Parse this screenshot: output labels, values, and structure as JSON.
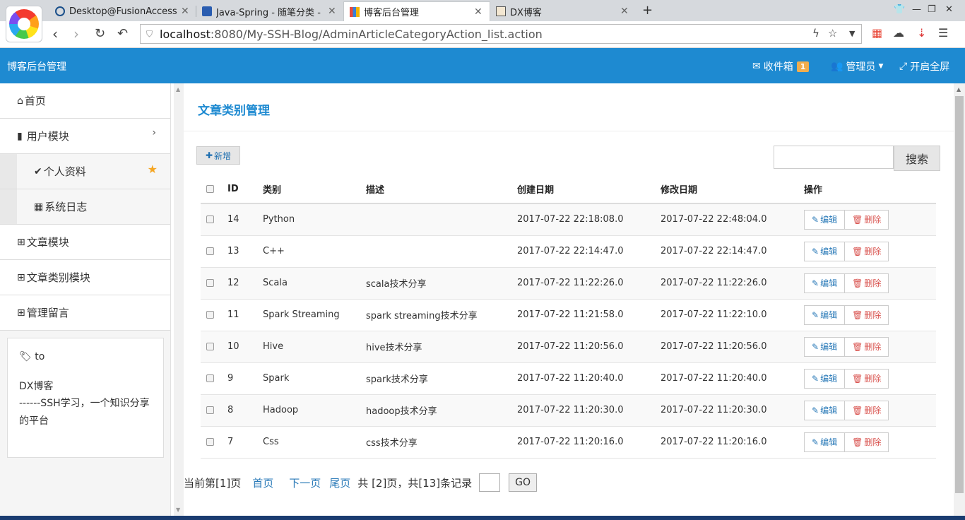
{
  "browser": {
    "tabs": [
      {
        "title": "Desktop@FusionAccess",
        "active": false
      },
      {
        "title": "Java-Spring - 随笔分类 - c",
        "active": false
      },
      {
        "title": "博客后台管理",
        "active": true
      },
      {
        "title": "DX博客",
        "active": false
      }
    ],
    "new_tab": "+",
    "url_host": "localhost",
    "url_path": ":8080/My-SSH-Blog/AdminArticleCategoryAction_list.action"
  },
  "header": {
    "brand": "博客后台管理",
    "inbox_label": "收件箱",
    "inbox_count": "1",
    "admin_label": "管理员",
    "fullscreen_label": "开启全屏"
  },
  "sidebar": {
    "items": [
      {
        "label": "首页",
        "icon": "home-icon"
      },
      {
        "label": "用户模块",
        "icon": "file-icon"
      },
      {
        "label": "个人资料",
        "icon": "check-icon"
      },
      {
        "label": "系统日志",
        "icon": "calendar-icon"
      },
      {
        "label": "文章模块",
        "icon": "table-icon"
      },
      {
        "label": "文章类别模块",
        "icon": "table-icon"
      },
      {
        "label": "管理留言",
        "icon": "table-icon"
      }
    ],
    "card": {
      "tag": "to",
      "name": "DX博客",
      "desc": "------SSH学习，一个知识分享的平台"
    }
  },
  "main": {
    "title": "文章类别管理",
    "add_label": "新增",
    "search_label": "搜索",
    "columns": [
      "ID",
      "类别",
      "描述",
      "创建日期",
      "修改日期",
      "操作"
    ],
    "edit_label": "编辑",
    "delete_label": "删除",
    "rows": [
      {
        "id": "14",
        "name": "Python",
        "desc": "",
        "created": "2017-07-22 22:18:08.0",
        "modified": "2017-07-22 22:48:04.0"
      },
      {
        "id": "13",
        "name": "C++",
        "desc": "",
        "created": "2017-07-22 22:14:47.0",
        "modified": "2017-07-22 22:14:47.0"
      },
      {
        "id": "12",
        "name": "Scala",
        "desc": "scala技术分享",
        "created": "2017-07-22 11:22:26.0",
        "modified": "2017-07-22 11:22:26.0"
      },
      {
        "id": "11",
        "name": "Spark Streaming",
        "desc": "spark streaming技术分享",
        "created": "2017-07-22 11:21:58.0",
        "modified": "2017-07-22 11:22:10.0"
      },
      {
        "id": "10",
        "name": "Hive",
        "desc": "hive技术分享",
        "created": "2017-07-22 11:20:56.0",
        "modified": "2017-07-22 11:20:56.0"
      },
      {
        "id": "9",
        "name": "Spark",
        "desc": "spark技术分享",
        "created": "2017-07-22 11:20:40.0",
        "modified": "2017-07-22 11:20:40.0"
      },
      {
        "id": "8",
        "name": "Hadoop",
        "desc": "hadoop技术分享",
        "created": "2017-07-22 11:20:30.0",
        "modified": "2017-07-22 11:20:30.0"
      },
      {
        "id": "7",
        "name": "Css",
        "desc": "css技术分享",
        "created": "2017-07-22 11:20:16.0",
        "modified": "2017-07-22 11:20:16.0"
      }
    ],
    "pager": {
      "current": "当前第[1]页",
      "first": "首页",
      "next": "下一页",
      "last": "尾页",
      "summary": "共 [2]页，共[13]条记录",
      "go": "GO"
    }
  },
  "colors": {
    "brand_blue": "#1e8ad1",
    "link_blue": "#2a7ab8",
    "delete_red": "#d9534f",
    "badge_orange": "#f0ad4e"
  }
}
